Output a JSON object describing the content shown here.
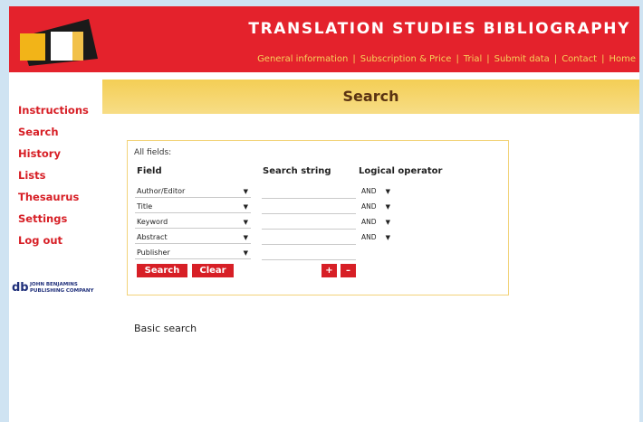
{
  "header": {
    "title": "TRANSLATION STUDIES BIBLIOGRAPHY",
    "nav": [
      "General information",
      "Subscription & Price",
      "Trial",
      "Submit data",
      "Contact",
      "Home"
    ]
  },
  "sidebar": {
    "items": [
      "Instructions",
      "Search",
      "History",
      "Lists",
      "Thesaurus",
      "Settings",
      "Log out"
    ]
  },
  "publisher_logo": {
    "mark": "db",
    "text": "JOHN BENJAMINS PUBLISHING COMPANY"
  },
  "page": {
    "title": "Search"
  },
  "search_form": {
    "all_fields_label": "All fields:",
    "columns": {
      "field": "Field",
      "search_string": "Search string",
      "operator": "Logical operator"
    },
    "rows": [
      {
        "field": "Author/Editor",
        "value": "",
        "operator": "AND"
      },
      {
        "field": "Title",
        "value": "",
        "operator": "AND"
      },
      {
        "field": "Keyword",
        "value": "",
        "operator": "AND"
      },
      {
        "field": "Abstract",
        "value": "",
        "operator": "AND"
      },
      {
        "field": "Publisher",
        "value": "",
        "operator": ""
      }
    ],
    "search_button": "Search",
    "clear_button": "Clear",
    "add_row_button": "+",
    "remove_row_button": "–"
  },
  "basic_search_link": "Basic search",
  "colors": {
    "brand_red": "#e4222c",
    "banner_yellow": "#f4ce55",
    "link_yellow": "#f7d25a",
    "background_blue": "#cfe3f2"
  }
}
